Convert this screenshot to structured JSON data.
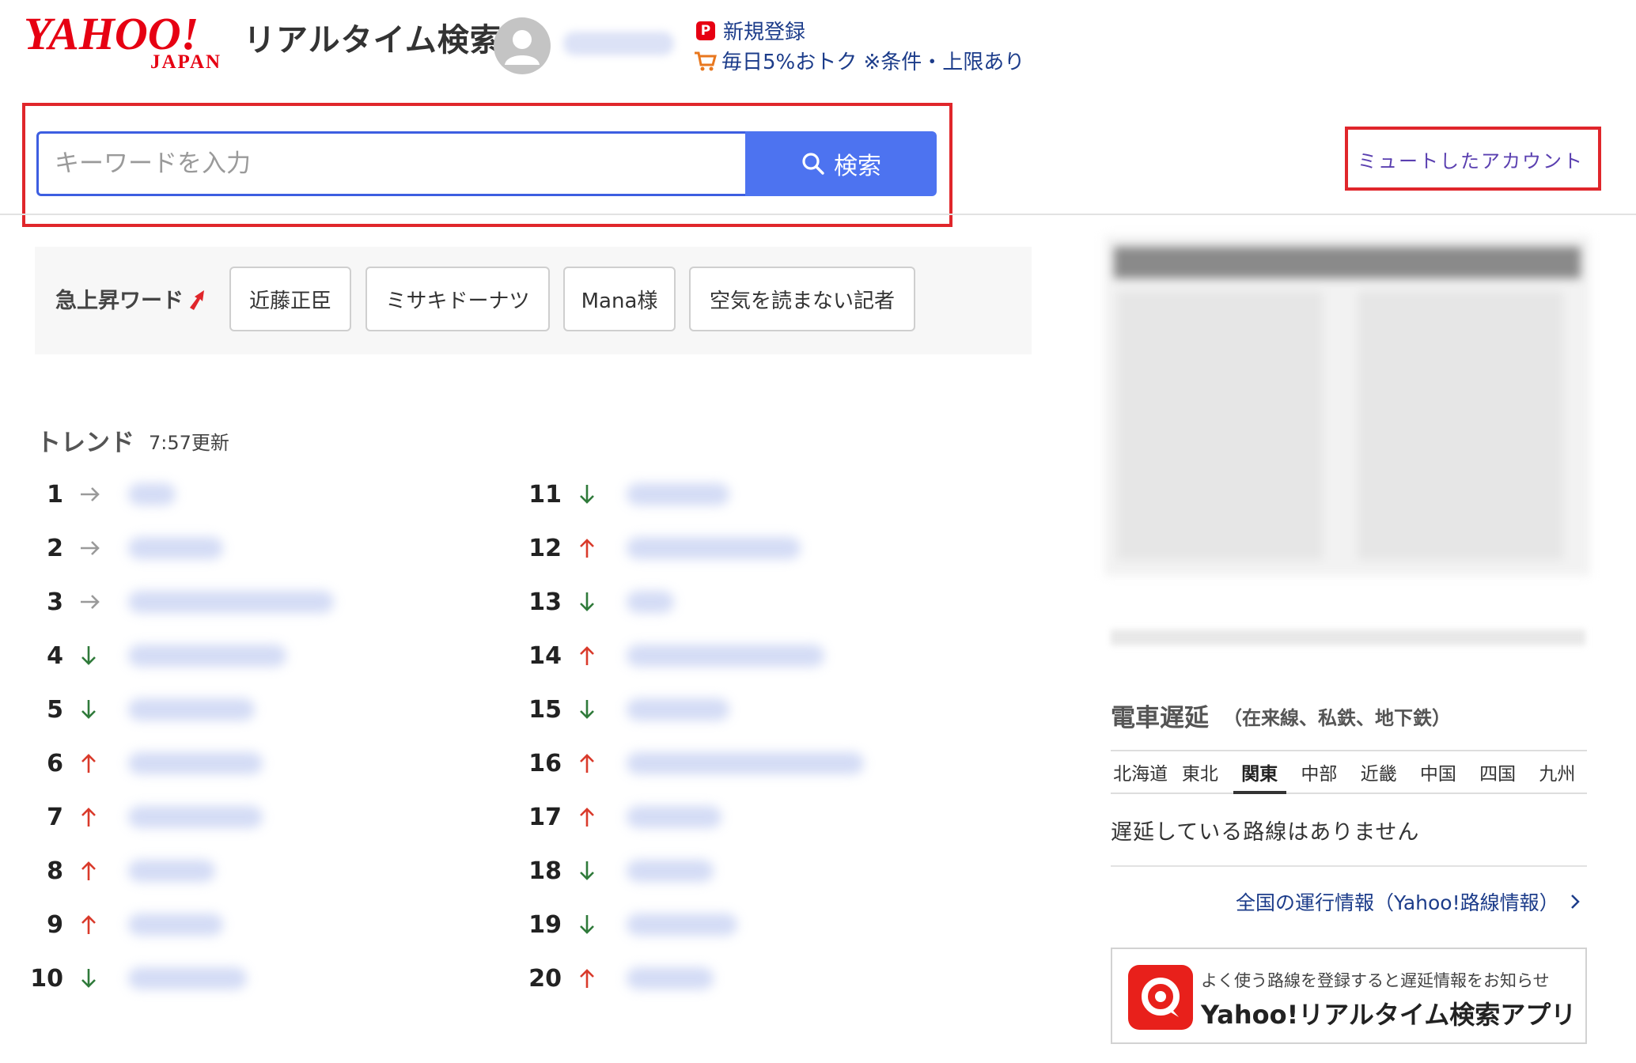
{
  "header": {
    "logo_main": "YAHOO!",
    "logo_sub": "JAPAN",
    "service_title": "リアルタイム検索",
    "promo": {
      "register_label": "新規登録",
      "paypay_badge": "P",
      "offer_label": "毎日5%おトク ※条件・上限あり"
    }
  },
  "search": {
    "placeholder": "キーワードを入力",
    "button_label": "検索"
  },
  "mute_link_label": "ミュートしたアカウント",
  "rising": {
    "label": "急上昇ワード",
    "chips": [
      "近藤正臣",
      "ミサキドーナツ",
      "Mana様",
      "空気を読まない記者"
    ]
  },
  "trends": {
    "title": "トレンド",
    "updated": "7:57更新",
    "rows": [
      {
        "rank": "1",
        "direction": "flat"
      },
      {
        "rank": "2",
        "direction": "flat"
      },
      {
        "rank": "3",
        "direction": "flat"
      },
      {
        "rank": "4",
        "direction": "down"
      },
      {
        "rank": "5",
        "direction": "down"
      },
      {
        "rank": "6",
        "direction": "up"
      },
      {
        "rank": "7",
        "direction": "up"
      },
      {
        "rank": "8",
        "direction": "up"
      },
      {
        "rank": "9",
        "direction": "up"
      },
      {
        "rank": "10",
        "direction": "down"
      },
      {
        "rank": "11",
        "direction": "down"
      },
      {
        "rank": "12",
        "direction": "up"
      },
      {
        "rank": "13",
        "direction": "down"
      },
      {
        "rank": "14",
        "direction": "up"
      },
      {
        "rank": "15",
        "direction": "down"
      },
      {
        "rank": "16",
        "direction": "up"
      },
      {
        "rank": "17",
        "direction": "up"
      },
      {
        "rank": "18",
        "direction": "down"
      },
      {
        "rank": "19",
        "direction": "down"
      },
      {
        "rank": "20",
        "direction": "up"
      }
    ]
  },
  "train": {
    "title": "電車遅延",
    "subtitle": "（在来線、私鉄、地下鉄）",
    "regions": [
      "北海道",
      "東北",
      "関東",
      "中部",
      "近畿",
      "中国",
      "四国",
      "九州"
    ],
    "active_region": "関東",
    "status": "遅延している路線はありません",
    "link_label": "全国の運行情報（Yahoo!路線情報）"
  },
  "app_banner": {
    "caption": "よく使う路線を登録すると遅延情報をお知らせ",
    "name": "Yahoo!リアルタイム検索アプリ"
  },
  "colors": {
    "accent_red": "#e0262b",
    "search_blue": "#4d73f0",
    "link_navy": "#1c3c8a",
    "arrow_up": "#d93a2b",
    "arrow_down": "#2f7a3a",
    "arrow_flat": "#9a9a9a"
  },
  "icons": [
    "paypay-icon",
    "cart-icon",
    "search-icon",
    "rising-arrow-icon",
    "user-icon",
    "app-icon",
    "chevron-right-icon"
  ]
}
